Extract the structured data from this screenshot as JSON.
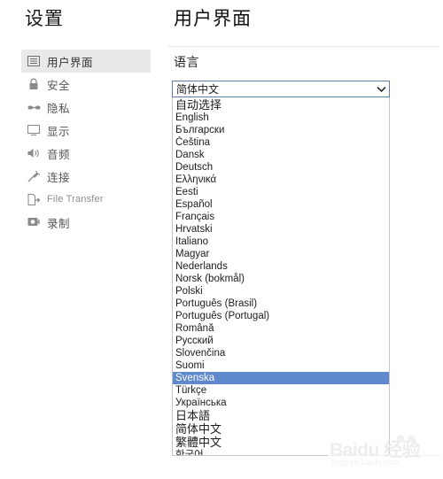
{
  "sidebar": {
    "title": "设置",
    "items": [
      {
        "label": "用户界面",
        "icon": "window-list-icon",
        "script": "cjk",
        "selected": true
      },
      {
        "label": "安全",
        "icon": "lock-icon",
        "script": "cjk",
        "selected": false
      },
      {
        "label": "隐私",
        "icon": "privacy-glasses-icon",
        "script": "cjk",
        "selected": false
      },
      {
        "label": "显示",
        "icon": "monitor-icon",
        "script": "cjk",
        "selected": false
      },
      {
        "label": "音频",
        "icon": "speaker-icon",
        "script": "cjk",
        "selected": false
      },
      {
        "label": "连接",
        "icon": "plug-icon",
        "script": "cjk",
        "selected": false
      },
      {
        "label": "File Transfer",
        "icon": "file-transfer-icon",
        "script": "latin",
        "selected": false
      },
      {
        "label": "录制",
        "icon": "record-camera-icon",
        "script": "cjk",
        "selected": false
      }
    ]
  },
  "content": {
    "page_title": "用户界面",
    "section_label": "语言",
    "language_select": {
      "value": "简体中文",
      "arrow_icon": "chevron-down-icon",
      "expanded": true,
      "options": [
        {
          "label": "自动选择",
          "script": "cjk",
          "highlighted": false
        },
        {
          "label": "English",
          "script": "latin",
          "highlighted": false
        },
        {
          "label": "Български",
          "script": "cyrillic",
          "highlighted": false
        },
        {
          "label": "Čeština",
          "script": "latin",
          "highlighted": false
        },
        {
          "label": "Dansk",
          "script": "latin",
          "highlighted": false
        },
        {
          "label": "Deutsch",
          "script": "latin",
          "highlighted": false
        },
        {
          "label": "Ελληνικά",
          "script": "greek",
          "highlighted": false
        },
        {
          "label": "Eesti",
          "script": "latin",
          "highlighted": false
        },
        {
          "label": "Español",
          "script": "latin",
          "highlighted": false
        },
        {
          "label": "Français",
          "script": "latin",
          "highlighted": false
        },
        {
          "label": "Hrvatski",
          "script": "latin",
          "highlighted": false
        },
        {
          "label": "Italiano",
          "script": "latin",
          "highlighted": false
        },
        {
          "label": "Magyar",
          "script": "latin",
          "highlighted": false
        },
        {
          "label": "Nederlands",
          "script": "latin",
          "highlighted": false
        },
        {
          "label": "Norsk (bokmål)",
          "script": "latin",
          "highlighted": false
        },
        {
          "label": "Polski",
          "script": "latin",
          "highlighted": false
        },
        {
          "label": "Português (Brasil)",
          "script": "latin",
          "highlighted": false
        },
        {
          "label": "Português (Portugal)",
          "script": "latin",
          "highlighted": false
        },
        {
          "label": "Română",
          "script": "latin",
          "highlighted": false
        },
        {
          "label": "Русский",
          "script": "cyrillic",
          "highlighted": false
        },
        {
          "label": "Slovenčina",
          "script": "latin",
          "highlighted": false
        },
        {
          "label": "Suomi",
          "script": "latin",
          "highlighted": false
        },
        {
          "label": "Svenska",
          "script": "latin",
          "highlighted": true
        },
        {
          "label": "Türkçe",
          "script": "latin",
          "highlighted": false
        },
        {
          "label": "Українська",
          "script": "cyrillic",
          "highlighted": false
        },
        {
          "label": "日本語",
          "script": "cjk",
          "highlighted": false
        },
        {
          "label": "简体中文",
          "script": "cjk",
          "highlighted": false
        },
        {
          "label": "繁體中文",
          "script": "cjk",
          "highlighted": false
        },
        {
          "label": "한국어",
          "script": "cjk-small",
          "highlighted": false
        }
      ]
    }
  },
  "watermark": {
    "brand": "Baidu 经验",
    "url": "jingyan.baidu.com",
    "paw_icon": "paw-print-icon"
  },
  "colors": {
    "highlight": "#5f89cc",
    "select_border": "#5d7fae",
    "sidebar_selected_bg": "#e9e9e9",
    "divider": "#e6e6e6",
    "list_border": "#c4c4c4",
    "text": "#1c1c1c",
    "muted_text": "#8d8d8d"
  }
}
